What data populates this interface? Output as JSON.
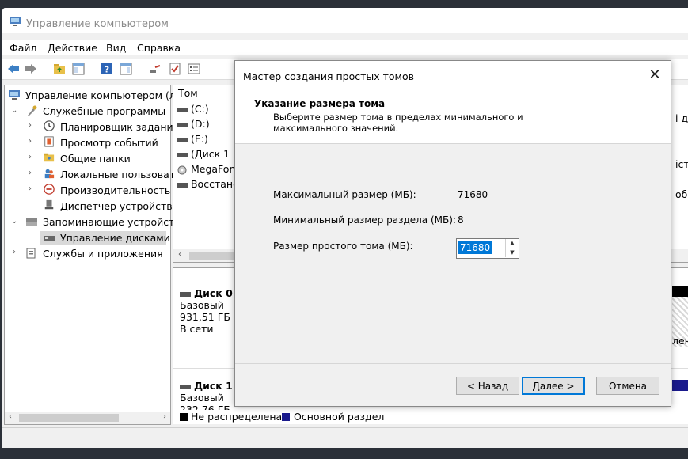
{
  "window": {
    "title": "Управление компьютером"
  },
  "menu": [
    "Файл",
    "Действие",
    "Вид",
    "Справка"
  ],
  "tree": {
    "root": "Управление компьютером (лс",
    "items": [
      "Служебные программы",
      "Планировщик заданий",
      "Просмотр событий",
      "Общие папки",
      "Локальные пользовате",
      "Производительность",
      "Диспетчер устройств",
      "Запоминающие устройств",
      "Управление дисками",
      "Службы и приложения"
    ]
  },
  "volumes": {
    "header": "Том",
    "rows": [
      "(C:)",
      "(D:)",
      "(E:)",
      "(Диск 1 р",
      "MegaFon",
      "Восстано"
    ],
    "right_fragments": [
      "і да",
      "іст",
      "обо"
    ]
  },
  "disks": [
    {
      "name": "Диск 0",
      "type": "Базовый",
      "size": "931,51 ГБ",
      "status": "В сети"
    },
    {
      "name": "Диск 1",
      "type": "Базовый",
      "size": "232,76 ГБ"
    }
  ],
  "disk_fragment": "лен",
  "legend": {
    "unallocated": "Не распределена",
    "primary": "Основной раздел"
  },
  "dialog": {
    "title": "Мастер создания простых томов",
    "heading": "Указание размера тома",
    "subheading": "Выберите размер тома в пределах минимального и максимального значений.",
    "max_label": "Максимальный размер (МБ):",
    "max_value": "71680",
    "min_label": "Минимальный размер раздела (МБ):",
    "min_value": "8",
    "size_label": "Размер простого тома (МБ):",
    "size_value": "71680",
    "back_button": "< Назад",
    "next_button": "Далее >",
    "cancel_button": "Отмена"
  }
}
